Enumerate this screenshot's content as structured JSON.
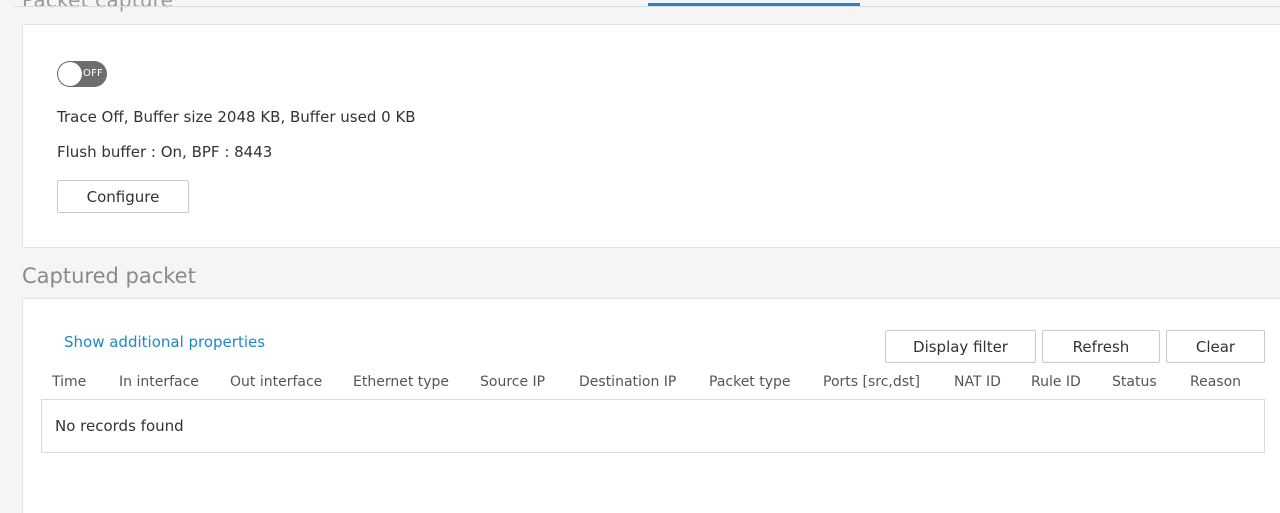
{
  "top": {
    "section_title": "Packet capture"
  },
  "capture": {
    "toggle_label": "OFF",
    "status_line": "Trace Off, Buffer size 2048 KB, Buffer used 0 KB",
    "settings_line": "Flush buffer : On, BPF : 8443",
    "configure_label": "Configure"
  },
  "captured": {
    "heading": "Captured packet",
    "show_properties_link": "Show additional properties",
    "buttons": {
      "display_filter": "Display filter",
      "refresh": "Refresh",
      "clear": "Clear"
    },
    "columns": [
      "Time",
      "In interface",
      "Out interface",
      "Ethernet type",
      "Source IP",
      "Destination IP",
      "Packet type",
      "Ports [src,dst]",
      "NAT ID",
      "Rule ID",
      "Status",
      "Reason"
    ],
    "empty_message": "No records found"
  },
  "colors": {
    "accent": "#1f86c8",
    "toggle_off": "#6e6e6e"
  }
}
